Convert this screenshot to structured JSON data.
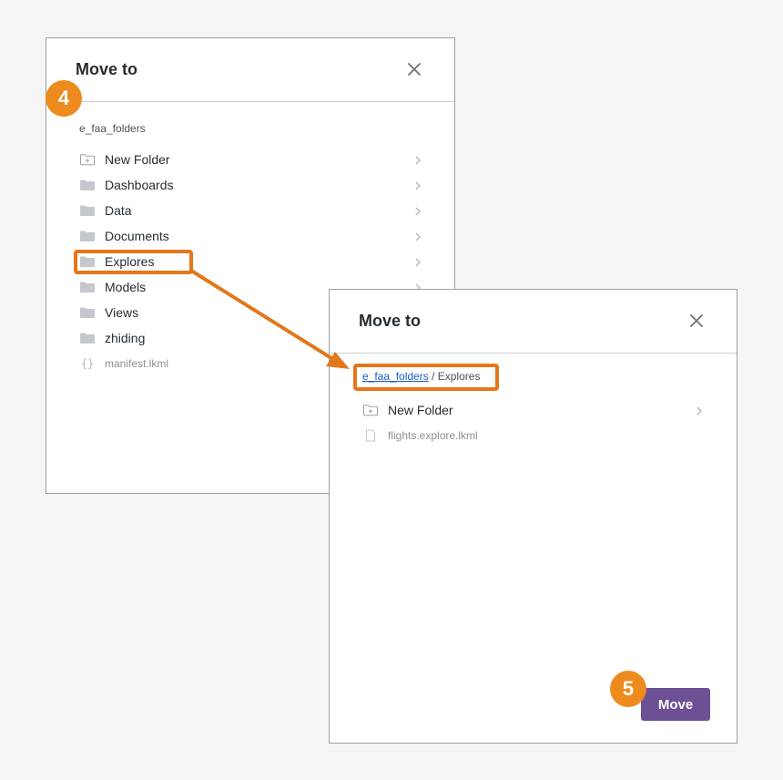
{
  "dialog_left": {
    "title": "Move to",
    "breadcrumb": "e_faa_folders",
    "items": [
      {
        "label": "New Folder",
        "kind": "new-folder",
        "icon": "folder-plus-icon"
      },
      {
        "label": "Dashboards",
        "kind": "folder",
        "icon": "folder-icon"
      },
      {
        "label": "Data",
        "kind": "folder",
        "icon": "folder-icon"
      },
      {
        "label": "Documents",
        "kind": "folder",
        "icon": "folder-icon"
      },
      {
        "label": "Explores",
        "kind": "folder",
        "icon": "folder-icon"
      },
      {
        "label": "Models",
        "kind": "folder",
        "icon": "folder-icon"
      },
      {
        "label": "Views",
        "kind": "folder",
        "icon": "folder-icon"
      },
      {
        "label": "zhiding",
        "kind": "folder",
        "icon": "folder-icon"
      },
      {
        "label": "manifest.lkml",
        "kind": "file",
        "icon": "braces-icon"
      }
    ]
  },
  "dialog_right": {
    "title": "Move to",
    "breadcrumb_link": "e_faa_folders",
    "breadcrumb_sep": " / ",
    "breadcrumb_current": "Explores",
    "items": [
      {
        "label": "New Folder",
        "kind": "new-folder",
        "icon": "folder-plus-icon"
      },
      {
        "label": "flights.explore.lkml",
        "kind": "file",
        "icon": "file-icon"
      }
    ],
    "move_label": "Move"
  },
  "badges": {
    "step_a": "4",
    "step_b": "5"
  },
  "colors": {
    "accent_orange": "#e3771a",
    "badge_orange": "#ed8b1e",
    "primary_purple": "#6c4f94",
    "folder_gray": "#c4c7cb",
    "link_blue": "#1a5ccc"
  }
}
